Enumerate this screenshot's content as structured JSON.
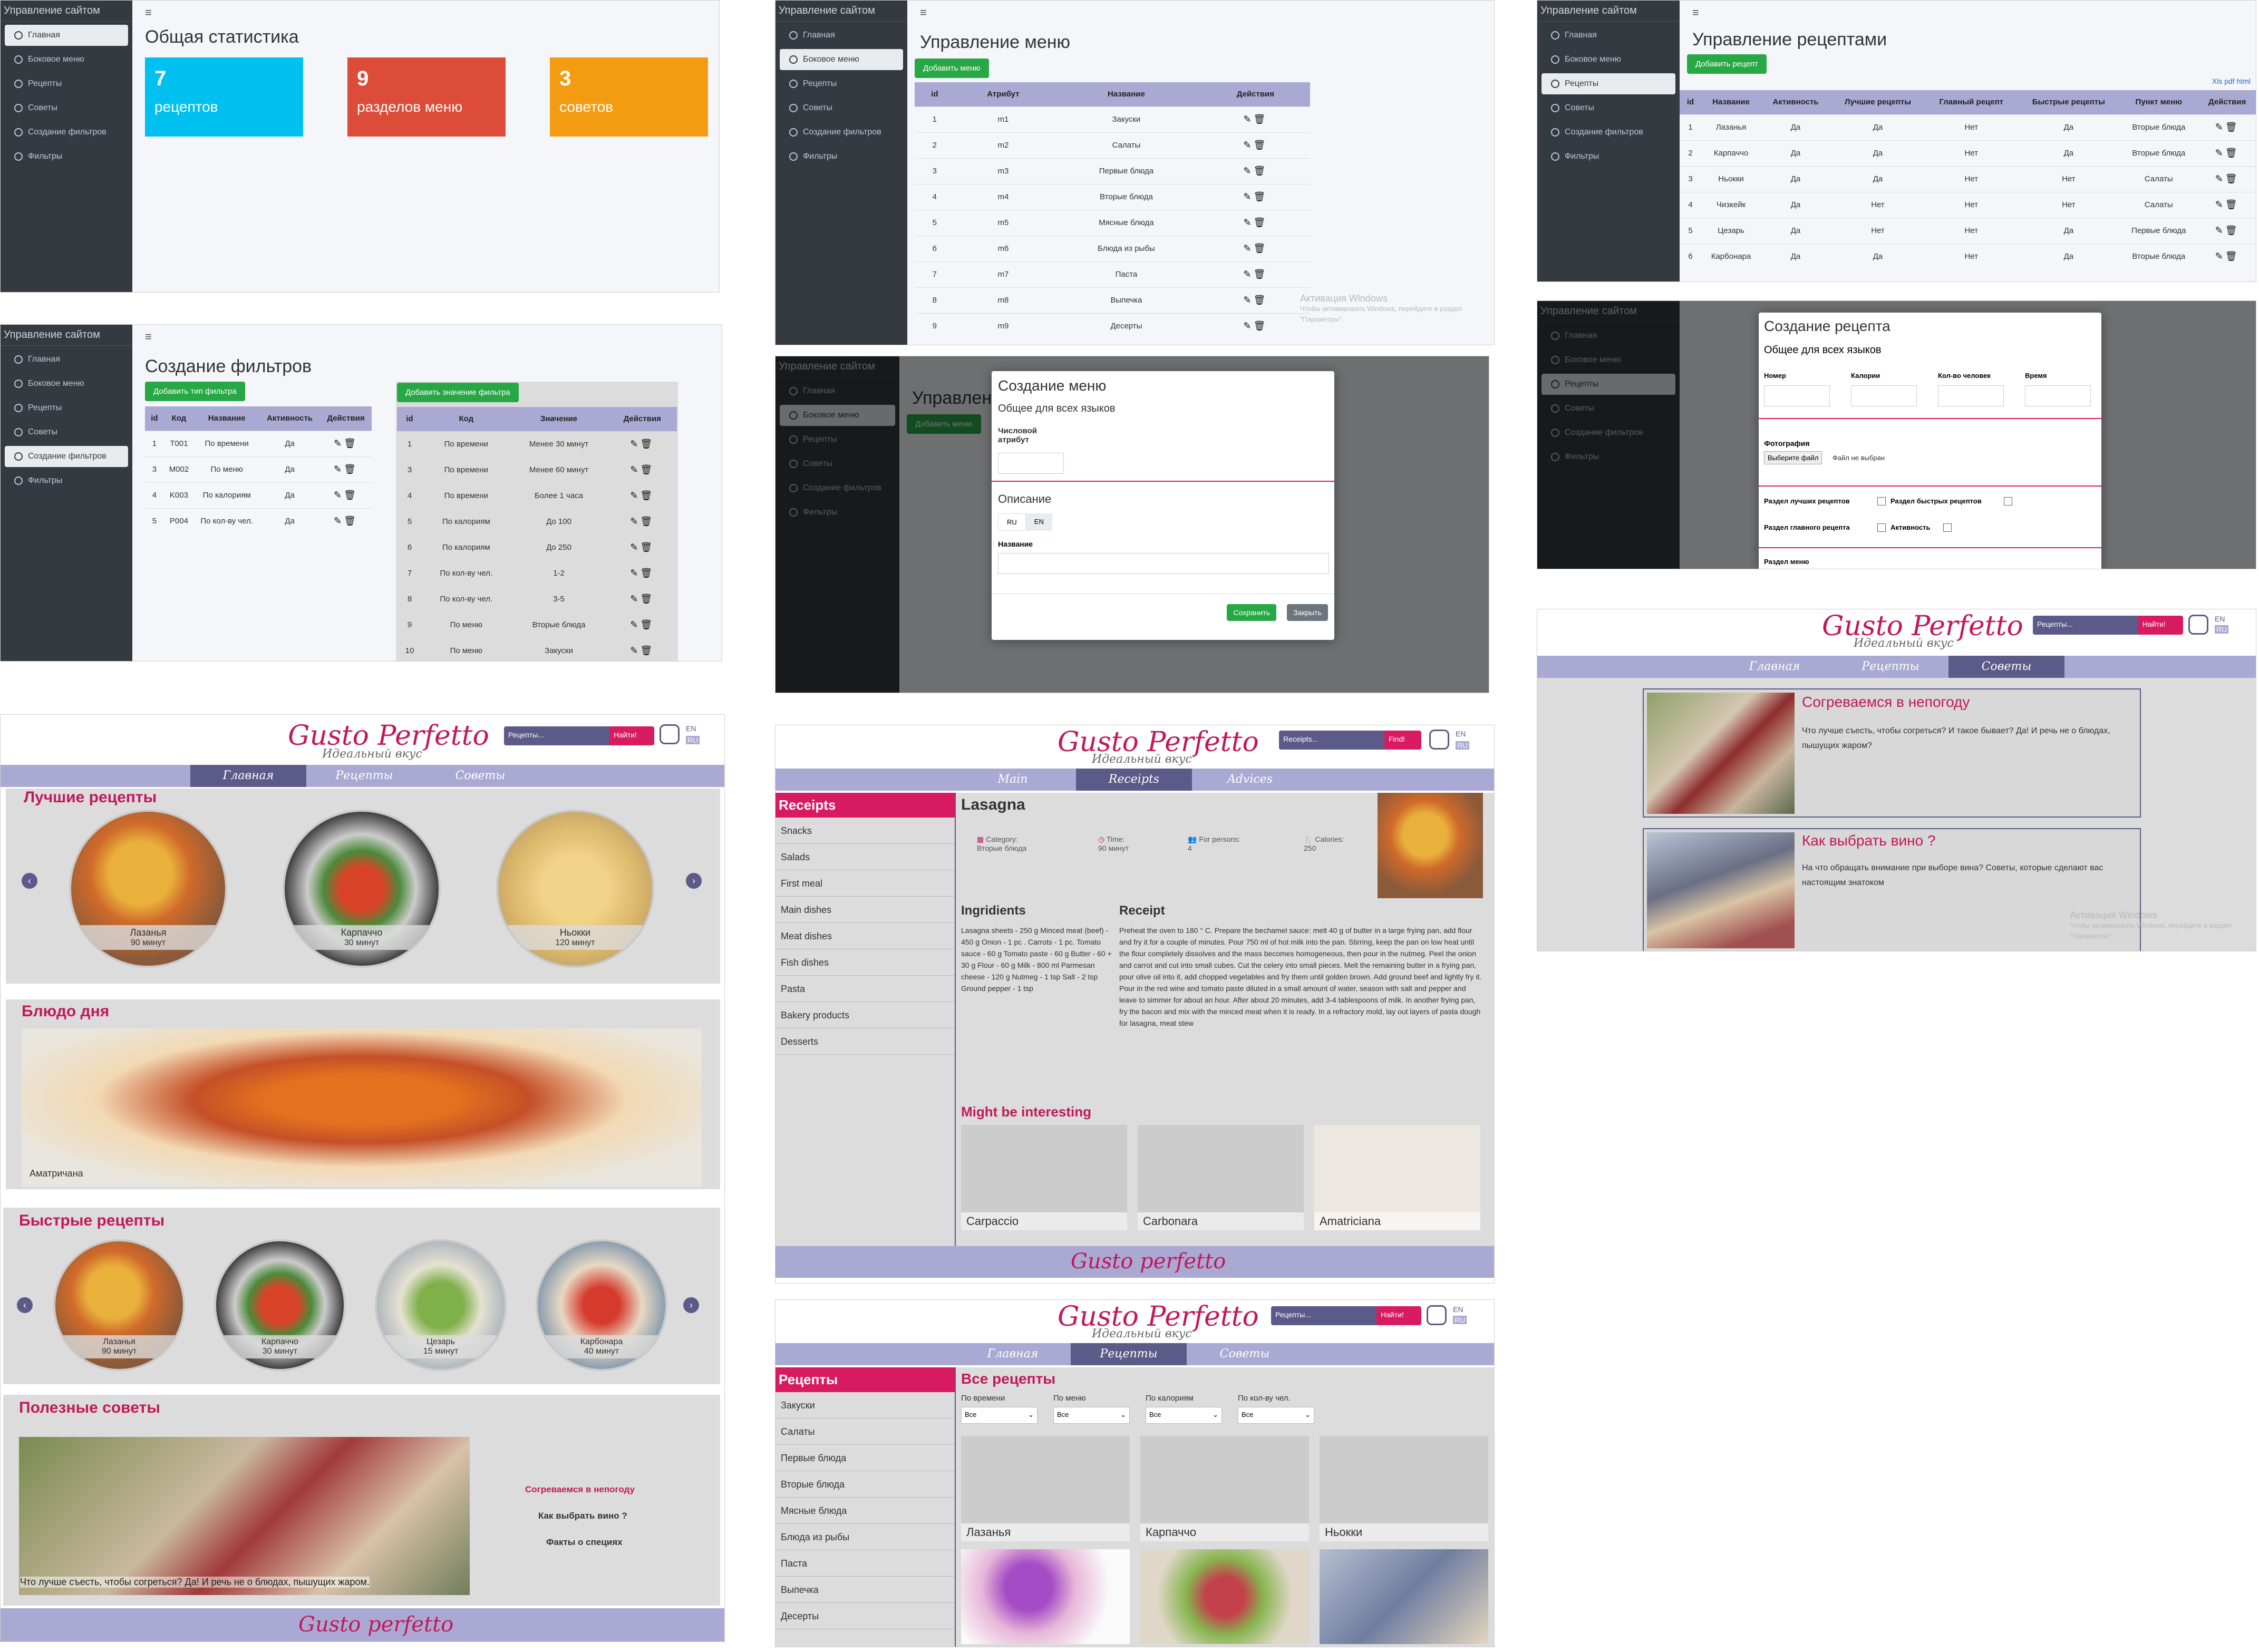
{
  "admin": {
    "brand": "Управление сайтом",
    "menu": [
      "Главная",
      "Боковое меню",
      "Рецепты",
      "Советы",
      "Создание фильтров",
      "Фильтры"
    ],
    "hamburger": "≡"
  },
  "stats": {
    "title": "Общая статистика",
    "tiles": [
      {
        "num": "7",
        "label": "рецептов",
        "color": "#00c0ef"
      },
      {
        "num": "9",
        "label": "разделов меню",
        "color": "#dd4b39"
      },
      {
        "num": "3",
        "label": "советов",
        "color": "#f39c12"
      }
    ]
  },
  "menu_mgmt": {
    "title": "Управление меню",
    "add_btn": "Добавить меню",
    "headers": [
      "id",
      "Атрибут",
      "Название",
      "Действия"
    ],
    "rows": [
      [
        "1",
        "m1",
        "Закуски"
      ],
      [
        "2",
        "m2",
        "Салаты"
      ],
      [
        "3",
        "m3",
        "Первые блюда"
      ],
      [
        "4",
        "m4",
        "Вторые блюда"
      ],
      [
        "5",
        "m5",
        "Мясные блюда"
      ],
      [
        "6",
        "m6",
        "Блюда из рыбы"
      ],
      [
        "7",
        "m7",
        "Паста"
      ],
      [
        "8",
        "m8",
        "Выпечка"
      ],
      [
        "9",
        "m9",
        "Десерты"
      ]
    ],
    "actions": "✎🗑"
  },
  "recipes_mgmt": {
    "title": "Управление рецептами",
    "add_btn": "Добавить рецепт",
    "export": "Xls pdf html",
    "headers": [
      "id",
      "Название",
      "Активность",
      "Лучшие рецепты",
      "Главный рецепт",
      "Быстрые рецепты",
      "Пункт меню",
      "Действия"
    ],
    "rows": [
      [
        "1",
        "Лазанья",
        "Да",
        "Да",
        "Нет",
        "Да",
        "Вторые блюда"
      ],
      [
        "2",
        "Карпаччо",
        "Да",
        "Да",
        "Нет",
        "Да",
        "Вторые блюда"
      ],
      [
        "3",
        "Ньокки",
        "Да",
        "Да",
        "Нет",
        "Нет",
        "Салаты"
      ],
      [
        "4",
        "Чизкейк",
        "Да",
        "Нет",
        "Нет",
        "Нет",
        "Салаты"
      ],
      [
        "5",
        "Цезарь",
        "Да",
        "Нет",
        "Нет",
        "Да",
        "Первые блюда"
      ],
      [
        "6",
        "Карбонара",
        "Да",
        "Да",
        "Нет",
        "Да",
        "Вторые блюда"
      ]
    ]
  },
  "filters_mgmt": {
    "title": "Создание фильтров",
    "add_type": "Добавить тип фильтра",
    "add_value": "Добавить значение фильтра",
    "type_headers": [
      "id",
      "Код",
      "Название",
      "Активность",
      "Действия"
    ],
    "type_rows": [
      [
        "1",
        "T001",
        "По времени",
        "Да"
      ],
      [
        "3",
        "M002",
        "По меню",
        "Да"
      ],
      [
        "4",
        "K003",
        "По калориям",
        "Да"
      ],
      [
        "5",
        "P004",
        "По кол-ву чел.",
        "Да"
      ]
    ],
    "value_headers": [
      "id",
      "Код",
      "Значение",
      "Действия"
    ],
    "value_rows": [
      [
        "1",
        "По времени",
        "Менее 30 минут"
      ],
      [
        "3",
        "По времени",
        "Менее 60 минут"
      ],
      [
        "4",
        "По времени",
        "Более 1 часа"
      ],
      [
        "5",
        "По калориям",
        "До 100"
      ],
      [
        "6",
        "По калориям",
        "До 250"
      ],
      [
        "7",
        "По кол-ву чел.",
        "1-2"
      ],
      [
        "8",
        "По кол-ву чел.",
        "3-5"
      ],
      [
        "9",
        "По меню",
        "Вторые блюда"
      ],
      [
        "10",
        "По меню",
        "Закуски"
      ]
    ]
  },
  "menu_modal": {
    "title": "Создание меню",
    "common": "Общее для всех языков",
    "num_attr": "Числовой атрибут",
    "desc": "Описание",
    "tab_ru": "RU",
    "tab_en": "EN",
    "name": "Название",
    "save": "Сохранить",
    "close": "Закрыть"
  },
  "recipe_modal": {
    "title": "Создание рецепта",
    "common": "Общее для всех языков",
    "fields": [
      "Номер",
      "Калории",
      "Кол-во человек",
      "Время"
    ],
    "photo": "Фотография",
    "choose": "Выберите файл",
    "nofile": "Файл не выбран",
    "best": "Раздел лучших рецептов",
    "fast": "Раздел быстрых рецептов",
    "main": "Раздел главного рецепта",
    "active": "Активность",
    "menu_section": "Раздел меню"
  },
  "watermark": {
    "line1": "Активация Windows",
    "line2": "Чтобы активировать Windows, перейдите в раздел \"Параметры\"."
  },
  "site": {
    "logo": "Gusto Perfetto",
    "tagline": "Идеальный вкус",
    "footer_logo": "Gusto perfetto",
    "search_ru": "Рецепты...",
    "find_ru": "Найти!",
    "search_en": "Receipts...",
    "find_en": "Find!",
    "lang_en": "EN",
    "lang_ru": "RU",
    "nav_ru": [
      "Главная",
      "Рецепты",
      "Советы"
    ],
    "nav_en": [
      "Main",
      "Receipts",
      "Advices"
    ]
  },
  "home": {
    "best_title": "Лучшие рецепты",
    "best": [
      {
        "name": "Лазанья",
        "time": "90 минут"
      },
      {
        "name": "Карпаччо",
        "time": "30 минут"
      },
      {
        "name": "Ньокки",
        "time": "120 минут"
      }
    ],
    "dish_title": "Блюдо дня",
    "dish_name": "Аматричана",
    "fast_title": "Быстрые рецепты",
    "fast": [
      {
        "name": "Лазанья",
        "time": "90 минут"
      },
      {
        "name": "Карпаччо",
        "time": "30 минут"
      },
      {
        "name": "Цезарь",
        "time": "15 минут"
      },
      {
        "name": "Карбонара",
        "time": "40 минут"
      }
    ],
    "tips_title": "Полезные советы",
    "tips": [
      "Согреваемся в непогоду",
      "Как выбрать вино ?",
      "Факты о специях"
    ],
    "tip_caption": "Что лучше съесть, чтобы согреться? Да! И речь не о блюдах, пышущих жаром."
  },
  "recipe_page": {
    "side_head": "Receipts",
    "side": [
      "Snacks",
      "Salads",
      "First meal",
      "Main dishes",
      "Meat dishes",
      "Fish dishes",
      "Pasta",
      "Bakery products",
      "Desserts"
    ],
    "title": "Lasagna",
    "meta": [
      {
        "label": "Category:",
        "value": "Вторые блюда"
      },
      {
        "label": "Time:",
        "value": "90 минут"
      },
      {
        "label": "For persons:",
        "value": "4"
      },
      {
        "label": "Calories:",
        "value": "250"
      }
    ],
    "ingr_title": "Ingridients",
    "ingr": "Lasagna sheets - 250 g Minced meat (beef) - 450 g Onion - 1 pc . Carrots - 1 pc. Tomato sauce - 60 g Tomato paste - 60 g Butter - 60 + 30 g Flour - 60 g Milk - 800 ml Parmesan cheese - 120 g Nutmeg - 1 tsp Salt - 2 tsp Ground pepper - 1 tsp",
    "receipt_title": "Receipt",
    "receipt": "Preheat the oven to 180 ° C. Prepare the bechamel sauce: melt 40 g of butter in a large frying pan, add flour and fry it for a couple of minutes. Pour 750 ml of hot milk into the pan. Stirring, keep the pan on low heat until the flour completely dissolves and the mass becomes homogeneous, then pour in the nutmeg. Peel the onion and carrot and cut into small cubes. Cut the celery into small pieces. Melt the remaining butter in a frying pan, pour olive oil into it, add chopped vegetables and fry them until golden brown. Add ground beef and lightly fry it. Pour in the red wine and tomato paste diluted in a small amount of water, season with salt and pepper and leave to simmer for about an hour. After about 20 minutes, add 3-4 tablespoons of milk. In another frying pan, fry the bacon and mix with the minced meat when it is ready. In a refractory mold, lay out layers of pasta dough for lasagna, meat stew",
    "interesting": "Might be interesting",
    "cards": [
      "Carpaccio",
      "Carbonara",
      "Amatriciana"
    ]
  },
  "tips_page": {
    "items": [
      {
        "title": "Согреваемся в непогоду",
        "text": "Что лучше съесть, чтобы согреться? И такое бывает? Да! И речь не о блюдах, пышущих жаром?"
      },
      {
        "title": "Как выбрать вино ?",
        "text": "На что обращать внимание при выборе вина? Советы, которые сделают вас настоящим знатоком"
      }
    ]
  },
  "catalog": {
    "side_head": "Рецепты",
    "side": [
      "Закуски",
      "Салаты",
      "Первые блюда",
      "Вторые блюда",
      "Мясные блюда",
      "Блюда из рыбы",
      "Паста",
      "Выпечка",
      "Десерты"
    ],
    "title": "Все рецепты",
    "filters": [
      "По времени",
      "По меню",
      "По калориям",
      "По кол-ву чел."
    ],
    "all": "Все",
    "cards": [
      "Лазанья",
      "Карпаччо",
      "Ньокки"
    ]
  }
}
